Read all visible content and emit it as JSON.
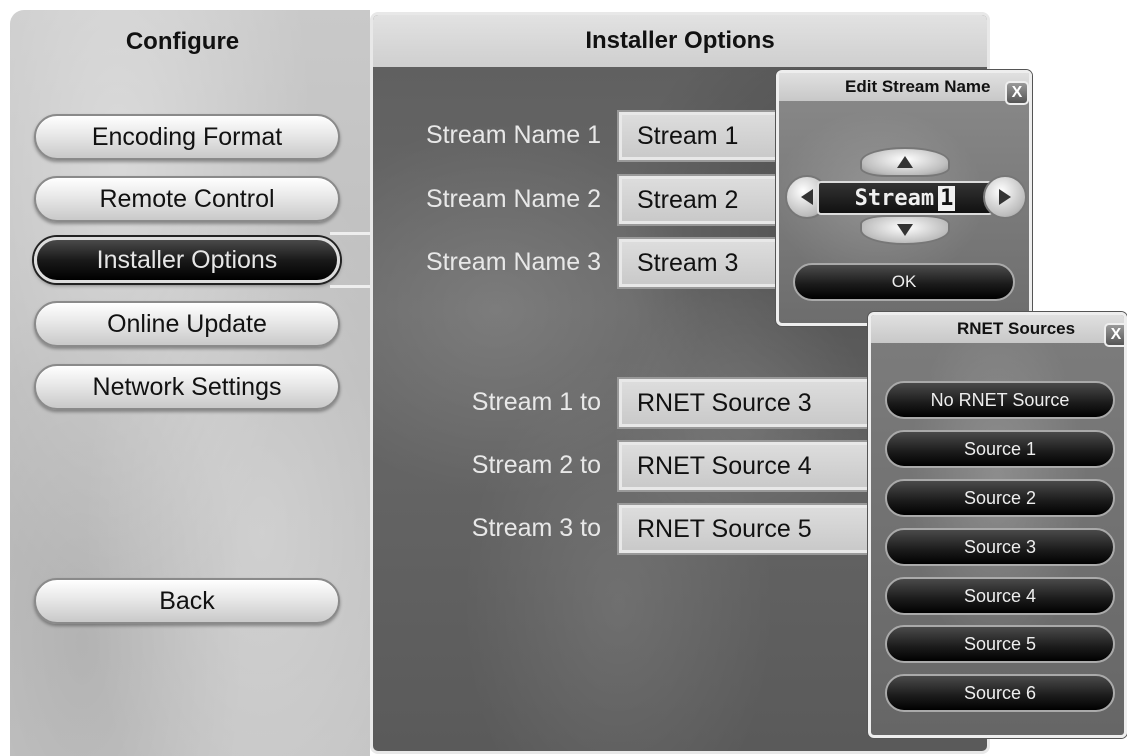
{
  "sidebar": {
    "title": "Configure",
    "items": [
      {
        "label": "Encoding Format"
      },
      {
        "label": "Remote Control"
      },
      {
        "label": "Installer Options"
      },
      {
        "label": "Online Update"
      },
      {
        "label": "Network Settings"
      }
    ],
    "back_label": "Back"
  },
  "main": {
    "title": "Installer Options",
    "stream_names": [
      {
        "label": "Stream Name 1",
        "value": "Stream 1"
      },
      {
        "label": "Stream Name 2",
        "value": "Stream 2"
      },
      {
        "label": "Stream Name 3",
        "value": "Stream 3"
      }
    ],
    "stream_routes": [
      {
        "label": "Stream 1 to",
        "value": "RNET Source 3"
      },
      {
        "label": "Stream 2 to",
        "value": "RNET Source 4"
      },
      {
        "label": "Stream 3 to",
        "value": "RNET Source 5"
      }
    ]
  },
  "edit_popup": {
    "title": "Edit Stream Name",
    "close_label": "X",
    "field_text": "Stream",
    "field_cursor_char": "1",
    "ok_label": "OK"
  },
  "rnet_popup": {
    "title": "RNET Sources",
    "close_label": "X",
    "options": [
      "No RNET Source",
      "Source 1",
      "Source 2",
      "Source 3",
      "Source 4",
      "Source 5",
      "Source 6"
    ]
  }
}
